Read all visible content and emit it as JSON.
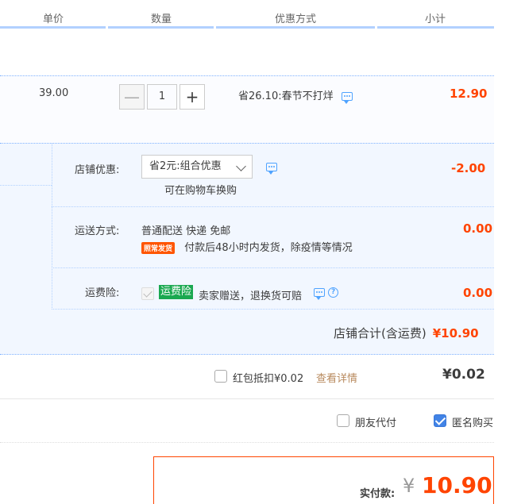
{
  "header": {
    "unit_price": "单价",
    "quantity": "数量",
    "discount_method": "优惠方式",
    "subtotal": "小计"
  },
  "item": {
    "price": "39.00",
    "quantity": "1",
    "minus": "—",
    "plus": "+",
    "promo": "省26.10:春节不打烊",
    "subtotal": "12.90"
  },
  "shop": {
    "discount_label": "店铺优惠:",
    "discount_select": "省2元:组合优惠",
    "discount_note": "可在购物车换购",
    "discount_amount": "-2.00",
    "shipping_label": "运送方式:",
    "shipping_method": "普通配送 快递 免邮",
    "shipping_badge": "照常发货",
    "shipping_note": "付款后48小时内发货，除疫情等情况",
    "shipping_amount": "0.00",
    "insurance_label": "运费险:",
    "insurance_badge": "运费险",
    "insurance_note": "卖家赠送，退换货可赔",
    "insurance_amount": "0.00",
    "total_label": "店铺合计(含运费)",
    "total_amount": "¥10.90"
  },
  "red_packet": {
    "label": "红包抵扣¥0.02",
    "detail_link": "查看详情",
    "amount": "¥0.02"
  },
  "options": {
    "friend_pay": "朋友代付",
    "anonymous": "匿名购买"
  },
  "pay": {
    "label": "实付款:",
    "yen": "¥",
    "amount": "10.90"
  },
  "colors": {
    "accent_red": "#ff4400",
    "link_blue": "#4fa3ff",
    "badge_green": "#1aa850",
    "checkbox_blue": "#4183e6"
  }
}
